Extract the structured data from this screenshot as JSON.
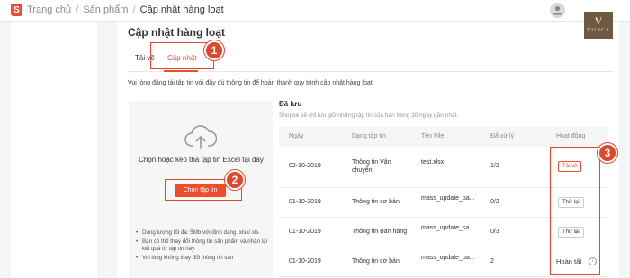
{
  "header": {
    "logo_letter": "S",
    "breadcrumb": {
      "home": "Trang chủ",
      "products": "Sản phẩm",
      "current": "Cập nhật hàng loạt",
      "separator": "/"
    },
    "brand_badge": {
      "mark": "V",
      "word": "VILICA"
    }
  },
  "main": {
    "title": "Cập nhật hàng loạt",
    "tabs": [
      {
        "label": "Tải về"
      },
      {
        "label": "Cập nhật"
      }
    ],
    "intro": "Vui lòng đăng tải tập tin với đầy đủ thông tin để hoàn thành quy trình cập nhật hàng loạt.",
    "upload": {
      "icon": "cloud-upload-icon",
      "prompt": "Chọn hoặc kéo thả tập tin Excel tại đây",
      "button_label": "Chọn tập tin",
      "notes": [
        "Dung lượng tối đa: 5Mb với định dạng .xlsx/.xls",
        "Bạn có thể thay đổi thông tin sản phẩm và nhận lại kết quả từ tập tin này.",
        "Vui lòng không thay đổi thông tin sản"
      ]
    },
    "saved": {
      "title": "Đã lưu",
      "description": "Shopee sẽ chỉ lưu giữ những tập tin của bạn trong 30 ngày gần nhất.",
      "columns": [
        "Ngày",
        "Dạng tập tin",
        "Tên File",
        "Đã xử lý",
        "Hoạt động"
      ],
      "rows": [
        {
          "date": "02-10-2019",
          "type_line1": "Thông tin Vận",
          "type_line2": "chuyển",
          "file": "test.xlsx",
          "processed": "1/2",
          "action": "Tải về"
        },
        {
          "date": "01-10-2019",
          "type": "Thông tin cơ bản",
          "file": "mass_update_ba...",
          "processed": "0/2",
          "action": "Thử lại"
        },
        {
          "date": "01-10-2019",
          "type": "Thông tin Bán hàng",
          "file": "mass_update_sa...",
          "processed": "0/3",
          "action": "Thử lại"
        },
        {
          "date": "01-10-2019",
          "type": "Thông tin cơ bản",
          "file": "mass_update_ba...",
          "processed": "2",
          "action": "Hoàn tất"
        }
      ]
    }
  },
  "steps": [
    "1",
    "2",
    "3"
  ],
  "colors": {
    "accent": "#ee4d2d",
    "highlight": "#e0472b"
  }
}
